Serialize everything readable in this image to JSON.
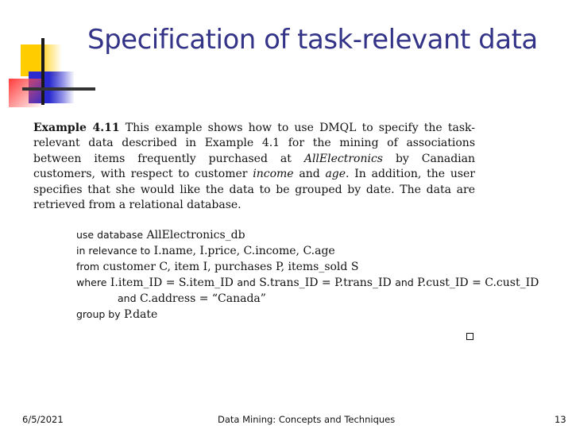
{
  "slide": {
    "title": "Specification of task-relevant data",
    "logo_icon": "decorative-color-blocks-logo",
    "colors": {
      "title": "#333388",
      "logo_yellow": "#ffcc00",
      "logo_blue": "#2a2ad0",
      "logo_red": "#ff3a3a"
    }
  },
  "example": {
    "label": "Example 4.11",
    "text_1": " This example shows how to use DMQL to specify the task-relevant data described in Example 4.1 for the mining of associations between items frequently purchased at ",
    "italic_1": "AllElectronics",
    "text_2": " by Canadian customers, with respect to customer ",
    "italic_2": "income",
    "text_3": " and ",
    "italic_3": "age",
    "text_4": ". In addition, the user specifies that she would like the data to be grouped by date. The data are retrieved from a relational database."
  },
  "query": {
    "lines": [
      {
        "keyword": "use database",
        "rest": " AllElectronics_db"
      },
      {
        "keyword": "in relevance to",
        "rest": " I.name, I.price, C.income, C.age"
      },
      {
        "keyword": "from",
        "rest": " customer C, item I, purchases P, items_sold S"
      },
      {
        "keyword": "where",
        "rest_a": " I.item_ID = S.item_ID ",
        "kw_and_1": "and",
        "rest_b": " S.trans_ID = P.trans_ID ",
        "kw_and_2": "and",
        "rest_c": " P.cust_ID = C.cust_ID"
      },
      {
        "keyword": "and",
        "rest": " C.address = “Canada”"
      },
      {
        "keyword": "group by",
        "rest": " P.date"
      }
    ]
  },
  "end_mark_icon": "qed-square-icon",
  "footer": {
    "date": "6/5/2021",
    "center": "Data Mining: Concepts and Techniques",
    "page_number": "13"
  }
}
